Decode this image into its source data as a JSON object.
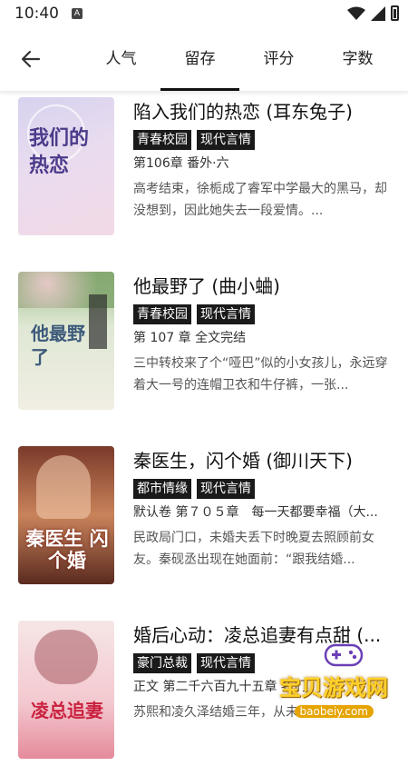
{
  "status": {
    "time": "10:40",
    "notif_icon": "A"
  },
  "header": {
    "back_icon": "arrow-left-icon",
    "tabs": [
      {
        "label": "人气"
      },
      {
        "label": "留存"
      },
      {
        "label": "评分"
      },
      {
        "label": "字数"
      }
    ]
  },
  "books": [
    {
      "title": "陷入我们的热恋 (耳东兔子)",
      "tags": [
        "青春校园",
        "现代言情"
      ],
      "chapter": "第106章 番外·六",
      "desc": "高考结束，徐栀成了睿军中学最大的黑马，却没想到，因此她失去一段爱情。...",
      "cover_text": "我们的热恋"
    },
    {
      "title": "他最野了 (曲小蛐)",
      "tags": [
        "青春校园",
        "现代言情"
      ],
      "chapter": "第 107 章 全文完结",
      "desc": "三中转校来了个“哑巴”似的小女孩儿，永远穿着大一号的连帽卫衣和牛仔裤，一张...",
      "cover_text": "他最野了"
    },
    {
      "title": "秦医生，闪个婚 (御川天下)",
      "tags": [
        "都市情缘",
        "现代言情"
      ],
      "chapter": "默认卷 第７０５章　每一天都要幸福（大...",
      "desc": "民政局门口，未婚夫丢下时晚夏去照顾前女友。秦砚丞出现在她面前：“跟我结婚...",
      "cover_text": "秦医生 闪个婚"
    },
    {
      "title": "婚后心动：凌总追妻有点甜 (...",
      "tags": [
        "豪门总裁",
        "现代言情"
      ],
      "chapter": "正文 第二千六百九十五章 我们",
      "desc": "苏熙和凌久泽结婚三年，从未露面，极少",
      "cover_text": "凌总追妻"
    }
  ],
  "watermark": {
    "text": "宝贝游戏网",
    "url": "baobeiy.com"
  }
}
